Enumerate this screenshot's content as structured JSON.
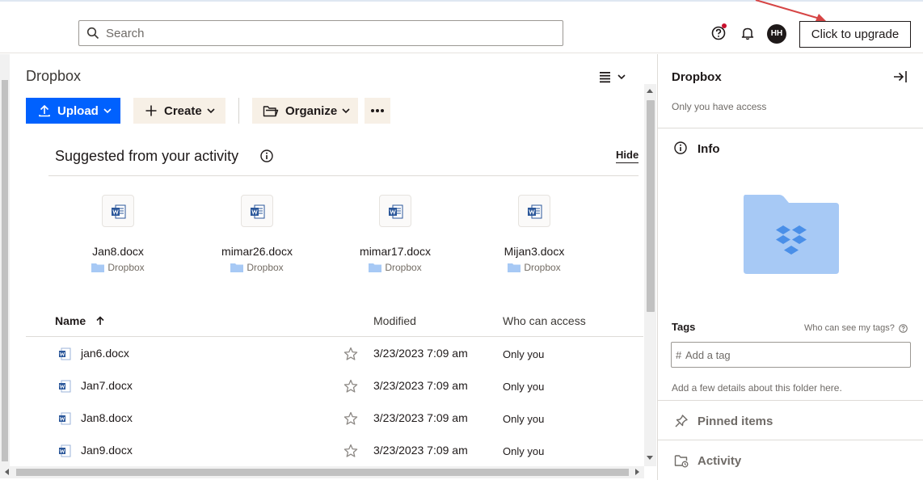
{
  "search": {
    "placeholder": "Search"
  },
  "header": {
    "upgrade_label": "Click to upgrade",
    "avatar_initials": "HH"
  },
  "main": {
    "breadcrumb": "Dropbox",
    "toolbar": {
      "upload_label": "Upload",
      "create_label": "Create",
      "organize_label": "Organize"
    },
    "suggested": {
      "title": "Suggested from your activity",
      "hide_label": "Hide",
      "items": [
        {
          "name": "Jan8.docx",
          "location": "Dropbox"
        },
        {
          "name": "mimar26.docx",
          "location": "Dropbox"
        },
        {
          "name": "mimar17.docx",
          "location": "Dropbox"
        },
        {
          "name": "Mijan3.docx",
          "location": "Dropbox"
        }
      ]
    },
    "table": {
      "headers": {
        "name": "Name",
        "modified": "Modified",
        "access": "Who can access"
      },
      "rows": [
        {
          "name": "jan6.docx",
          "modified": "3/23/2023 7:09 am",
          "access": "Only you"
        },
        {
          "name": "Jan7.docx",
          "modified": "3/23/2023 7:09 am",
          "access": "Only you"
        },
        {
          "name": "Jan8.docx",
          "modified": "3/23/2023 7:09 am",
          "access": "Only you"
        },
        {
          "name": "Jan9.docx",
          "modified": "3/23/2023 7:09 am",
          "access": "Only you"
        }
      ]
    }
  },
  "panel": {
    "title": "Dropbox",
    "subtitle": "Only you have access",
    "info_label": "Info",
    "tags_label": "Tags",
    "tags_question": "Who can see my tags?",
    "tag_hash": "#",
    "tag_placeholder": "Add a tag",
    "details_hint": "Add a few details about this folder here.",
    "pinned_label": "Pinned items",
    "activity_label": "Activity"
  },
  "colors": {
    "accent": "#0061fe",
    "secondary_button": "#f7f0e6",
    "folder": "#a7c9f5",
    "word": "#2b579a"
  }
}
